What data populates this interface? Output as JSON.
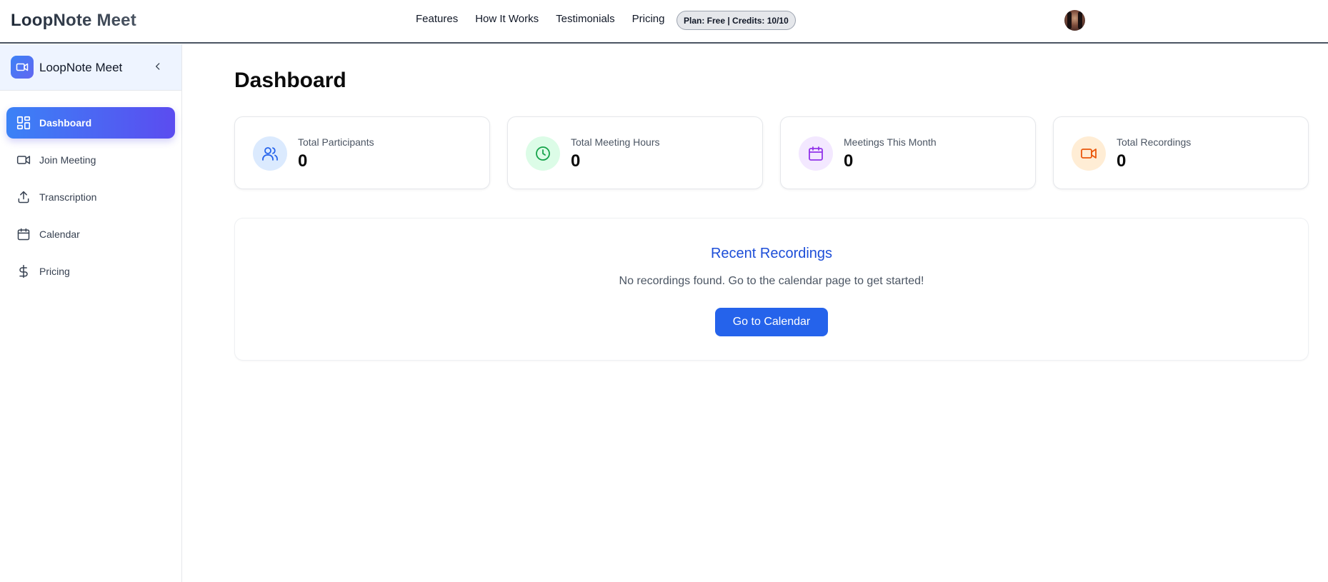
{
  "app": {
    "brand": "LoopNote Meet"
  },
  "nav": {
    "links": [
      "Features",
      "How It Works",
      "Testimonials",
      "Pricing"
    ],
    "plan_badge": "Plan: Free | Credits: 10/10"
  },
  "sidebar": {
    "title": "LoopNote Meet",
    "items": [
      {
        "label": "Dashboard",
        "icon": "dashboard-icon",
        "active": true
      },
      {
        "label": "Join Meeting",
        "icon": "video-icon"
      },
      {
        "label": "Transcription",
        "icon": "upload-icon"
      },
      {
        "label": "Calendar",
        "icon": "calendar-icon"
      },
      {
        "label": "Pricing",
        "icon": "dollar-icon"
      }
    ]
  },
  "main": {
    "title": "Dashboard",
    "stats": [
      {
        "label": "Total Participants",
        "value": "0",
        "icon": "users-icon",
        "color": "#2563eb",
        "bg": "#dbeafe"
      },
      {
        "label": "Total Meeting Hours",
        "value": "0",
        "icon": "clock-icon",
        "color": "#16a34a",
        "bg": "#dcfce7"
      },
      {
        "label": "Meetings This Month",
        "value": "0",
        "icon": "calendar-icon",
        "color": "#9333ea",
        "bg": "#f3e8ff"
      },
      {
        "label": "Total Recordings",
        "value": "0",
        "icon": "video-icon",
        "color": "#ea580c",
        "bg": "#ffedd5"
      }
    ],
    "recordings": {
      "title": "Recent Recordings",
      "empty_text": "No recordings found. Go to the calendar page to get started!",
      "button_label": "Go to Calendar"
    }
  },
  "colors": {
    "accent": "#2563eb",
    "accent_gradient_end": "#5b4cf0",
    "border": "#e5e7eb"
  }
}
